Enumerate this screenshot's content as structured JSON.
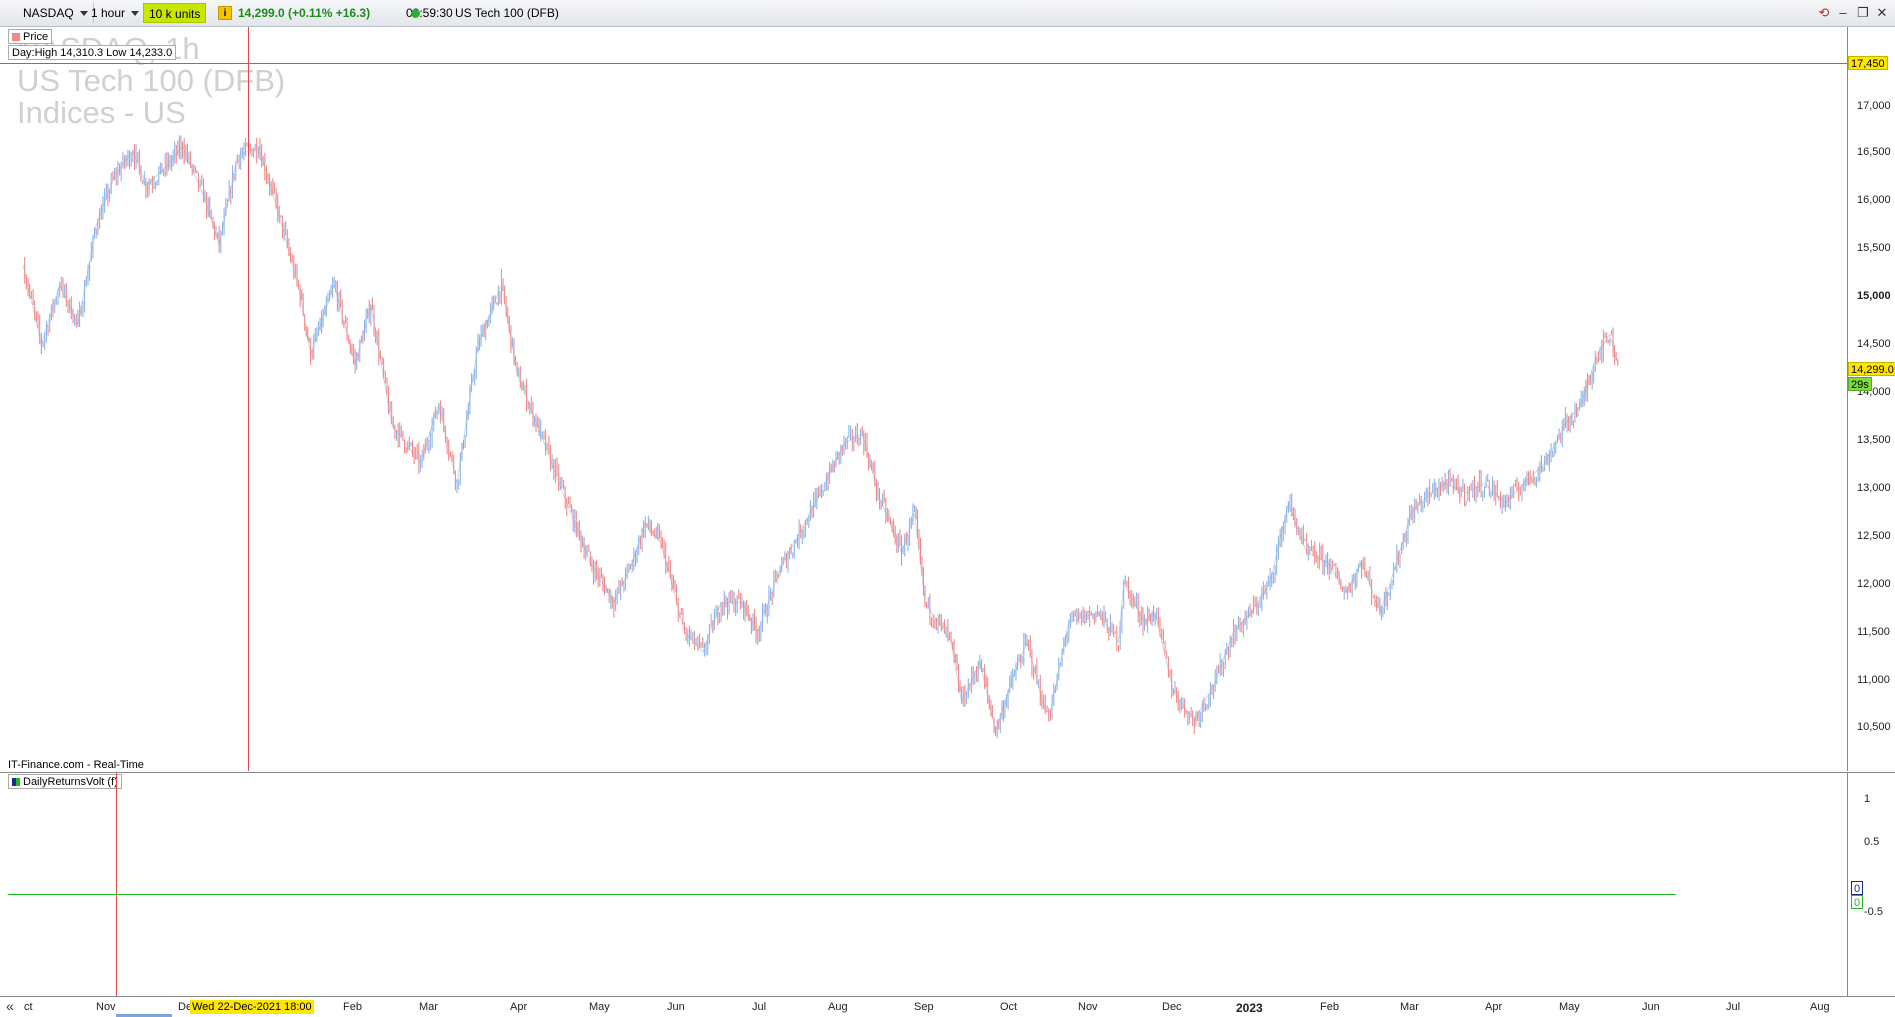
{
  "toolbar": {
    "market": "NASDAQ",
    "interval": "1 hour",
    "units": "10 k units",
    "info_glyph": "i",
    "price_change": "14,299.0 (+0.11% +16.3)",
    "clock": "09:59:30",
    "instrument": "US Tech 100 (DFB)",
    "icons": [
      "link-icon",
      "minimize-icon",
      "restore-icon",
      "close-icon"
    ]
  },
  "price_panel": {
    "legend": "Price",
    "day_range": "Day:High 14,310.3 Low 14,233.0",
    "watermark": [
      "NASDAQ, 1h",
      "US Tech 100 (DFB)",
      "Indices - US"
    ],
    "source": "IT-Finance.com - Real-Time",
    "level_tag": "17,450",
    "last_price_tag": "14,299.0",
    "countdown_tag": "29s",
    "axis_labels": [
      "17,000",
      "16,500",
      "16,000",
      "15,500",
      "15,000",
      "14,500",
      "14,000",
      "13,500",
      "13,000",
      "12,500",
      "12,000",
      "11,500",
      "11,000",
      "10,500"
    ]
  },
  "indicator_panel": {
    "legend": "DailyReturnsVolt (f)",
    "axis_labels": [
      "1",
      "0.5",
      "-0.5"
    ],
    "tag_a": "0",
    "tag_b": "0"
  },
  "time_axis": {
    "scroll_glyph": "«",
    "crosshair_label": "Wed 22-Dec-2021 18:00",
    "labels": [
      "ct",
      "Nov",
      "De",
      "Feb",
      "Mar",
      "Apr",
      "May",
      "Jun",
      "Jul",
      "Aug",
      "Sep",
      "Oct",
      "Nov",
      "Dec",
      "2023",
      "Feb",
      "Mar",
      "Apr",
      "May",
      "Jun",
      "Jul",
      "Aug"
    ]
  },
  "colors": {
    "up": "#8fb4e6",
    "down": "#f08a8a",
    "crosshair": "#e2484c",
    "indicator_line": "#22bb22",
    "tag_yellow": "#ffe600",
    "tag_green": "#7ddc3a",
    "toolbar_highlight": "#c9e600"
  },
  "chart_data": {
    "type": "line",
    "ylim": [
      10200,
      17700
    ],
    "x": [
      "2021-10-06",
      "2021-10-13",
      "2021-10-20",
      "2021-10-27",
      "2021-11-03",
      "2021-11-10",
      "2021-11-17",
      "2021-11-22",
      "2021-11-30",
      "2021-12-06",
      "2021-12-14",
      "2021-12-20",
      "2021-12-27",
      "2022-01-04",
      "2022-01-12",
      "2022-01-20",
      "2022-01-24",
      "2022-02-02",
      "2022-02-10",
      "2022-02-16",
      "2022-02-24",
      "2022-03-07",
      "2022-03-14",
      "2022-03-21",
      "2022-03-29",
      "2022-04-07",
      "2022-04-13",
      "2022-04-22",
      "2022-05-02",
      "2022-05-11",
      "2022-05-20",
      "2022-05-27",
      "2022-06-01",
      "2022-06-07",
      "2022-06-16",
      "2022-06-23",
      "2022-06-30",
      "2022-07-08",
      "2022-07-14",
      "2022-07-22",
      "2022-07-28",
      "2022-08-05",
      "2022-08-16",
      "2022-08-23",
      "2022-08-29",
      "2022-09-07",
      "2022-09-12",
      "2022-09-16",
      "2022-09-26",
      "2022-09-30",
      "2022-10-07",
      "2022-10-13",
      "2022-10-19",
      "2022-10-25",
      "2022-11-01",
      "2022-11-03",
      "2022-11-10",
      "2022-11-21",
      "2022-11-29",
      "2022-12-01",
      "2022-12-09",
      "2022-12-13",
      "2022-12-20",
      "2022-12-28",
      "2023-01-05",
      "2023-01-12",
      "2023-01-19",
      "2023-01-26",
      "2023-02-02",
      "2023-02-09",
      "2023-02-17",
      "2023-02-24",
      "2023-03-02",
      "2023-03-09",
      "2023-03-13",
      "2023-03-21",
      "2023-03-28",
      "2023-04-03",
      "2023-04-11",
      "2023-04-18",
      "2023-04-26",
      "2023-05-03",
      "2023-05-11",
      "2023-05-19",
      "2023-05-25",
      "2023-05-31",
      "2023-06-05",
      "2023-06-08"
    ],
    "values": [
      15300,
      14500,
      15100,
      14700,
      15700,
      16200,
      16450,
      16100,
      16300,
      16500,
      16000,
      15500,
      16400,
      16500,
      15800,
      15000,
      14400,
      15100,
      14300,
      14900,
      13700,
      13300,
      13900,
      13100,
      14500,
      15100,
      14200,
      13600,
      12900,
      12300,
      11900,
      12300,
      12700,
      12500,
      11600,
      11400,
      11900,
      11900,
      11600,
      12200,
      12500,
      12900,
      13500,
      13600,
      13000,
      12400,
      12800,
      11900,
      11500,
      10900,
      11300,
      10600,
      11100,
      11500,
      10800,
      10800,
      11700,
      11800,
      11500,
      12100,
      11700,
      11800,
      11000,
      10700,
      11100,
      11600,
      11800,
      12100,
      12900,
      12400,
      12300,
      12000,
      12300,
      11800,
      12100,
      12800,
      13000,
      13100,
      13000,
      13100,
      12900,
      13100,
      13300,
      13700,
      13900,
      14400,
      14600,
      14300
    ]
  }
}
